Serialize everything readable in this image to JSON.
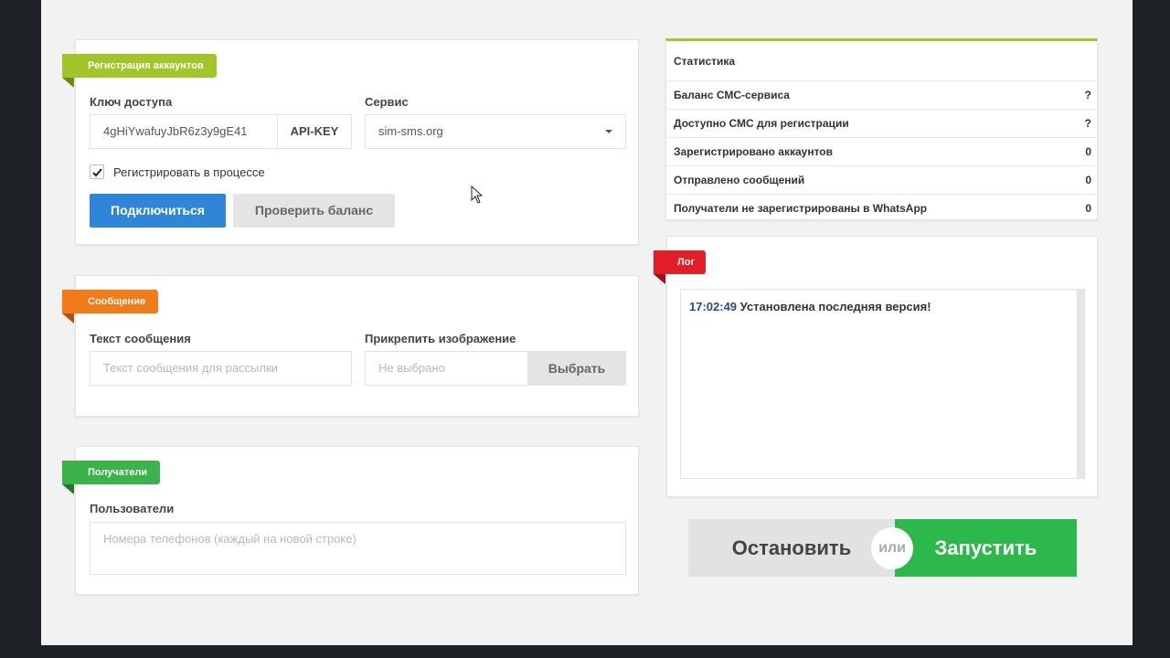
{
  "registration": {
    "ribbon": "Регистрация аккаунтов",
    "access_key_label": "Ключ доступа",
    "access_key_value": "4gHiYwafuyJbR6z3y9gE41",
    "api_key_addon": "API-KEY",
    "service_label": "Сервис",
    "service_value": "sim-sms.org",
    "register_checkbox_label": "Регистрировать в процессе",
    "register_checked": true,
    "connect_button": "Подключиться",
    "check_balance_button": "Проверить баланс"
  },
  "message": {
    "ribbon": "Сообщение",
    "text_label": "Текст сообщения",
    "text_placeholder": "Текст сообщения для рассылки",
    "attach_label": "Прикрепить изображение",
    "attach_placeholder": "Не выбрано",
    "choose_button": "Выбрать"
  },
  "recipients": {
    "ribbon": "Получатели",
    "users_label": "Пользователи",
    "users_placeholder": "Номера телефонов (каждый на новой строке)"
  },
  "stats": {
    "title": "Статистика",
    "rows": [
      {
        "key": "Баланс СМС-сервиса",
        "value": "?"
      },
      {
        "key": "Доступно СМС для регистрации",
        "value": "?"
      },
      {
        "key": "Зарегистрировано аккаунтов",
        "value": "0"
      },
      {
        "key": "Отправлено сообщений",
        "value": "0"
      },
      {
        "key": "Получатели не зарегистрированы в WhatsApp",
        "value": "0"
      }
    ]
  },
  "log": {
    "ribbon": "Лог",
    "entries": [
      {
        "time": "17:02:49",
        "text": "Установлена последняя версия!"
      }
    ]
  },
  "actions": {
    "stop_button": "Остановить",
    "or_text": "или",
    "start_button": "Запустить"
  },
  "colors": {
    "accent_blue": "#2f86d6",
    "ribbon_registration": "#a2c52a",
    "ribbon_message": "#f07b18",
    "ribbon_recipients": "#3ab34a",
    "ribbon_log": "#e21e26",
    "start_green": "#2db84a",
    "stats_top_border": "#a2c52a"
  }
}
